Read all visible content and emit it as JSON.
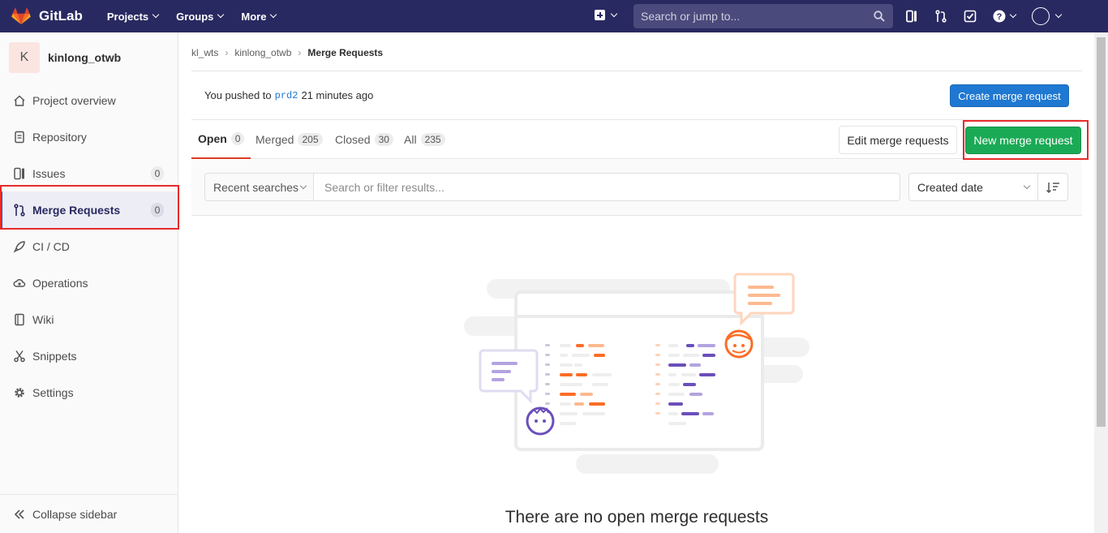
{
  "navbar": {
    "brand": "GitLab",
    "menu": [
      {
        "label": "Projects"
      },
      {
        "label": "Groups"
      },
      {
        "label": "More"
      }
    ],
    "search_placeholder": "Search or jump to..."
  },
  "sidebar": {
    "project_initial": "K",
    "project_name": "kinlong_otwb",
    "items": [
      {
        "label": "Project overview",
        "icon": "home-icon"
      },
      {
        "label": "Repository",
        "icon": "document-icon"
      },
      {
        "label": "Issues",
        "icon": "issues-icon",
        "badge": "0"
      },
      {
        "label": "Merge Requests",
        "icon": "merge-request-icon",
        "badge": "0"
      },
      {
        "label": "CI / CD",
        "icon": "rocket-icon"
      },
      {
        "label": "Operations",
        "icon": "cloud-gear-icon"
      },
      {
        "label": "Wiki",
        "icon": "book-icon"
      },
      {
        "label": "Snippets",
        "icon": "scissors-icon"
      },
      {
        "label": "Settings",
        "icon": "gear-icon"
      }
    ],
    "collapse_label": "Collapse sidebar"
  },
  "breadcrumb": {
    "items": [
      "kl_wts",
      "kinlong_otwb",
      "Merge Requests"
    ]
  },
  "push_notice": {
    "prefix": "You pushed to",
    "branch": "prd2",
    "suffix": "21 minutes ago",
    "create_button": "Create merge request"
  },
  "tabs": [
    {
      "label": "Open",
      "count": "0"
    },
    {
      "label": "Merged",
      "count": "205"
    },
    {
      "label": "Closed",
      "count": "30"
    },
    {
      "label": "All",
      "count": "235"
    }
  ],
  "actions": {
    "edit_button": "Edit merge requests",
    "new_button": "New merge request"
  },
  "filter": {
    "recent_label": "Recent searches",
    "placeholder": "Search or filter results...",
    "sort_value": "Created date"
  },
  "empty_state": {
    "title": "There are no open merge requests"
  },
  "colors": {
    "navbar": "#292961",
    "accent_blue": "#1f78d1",
    "accent_green": "#1aaa55",
    "highlight_red": "#e62b2b",
    "illustration_orange": "#fc6d26",
    "illustration_purple": "#6b4fbb"
  }
}
